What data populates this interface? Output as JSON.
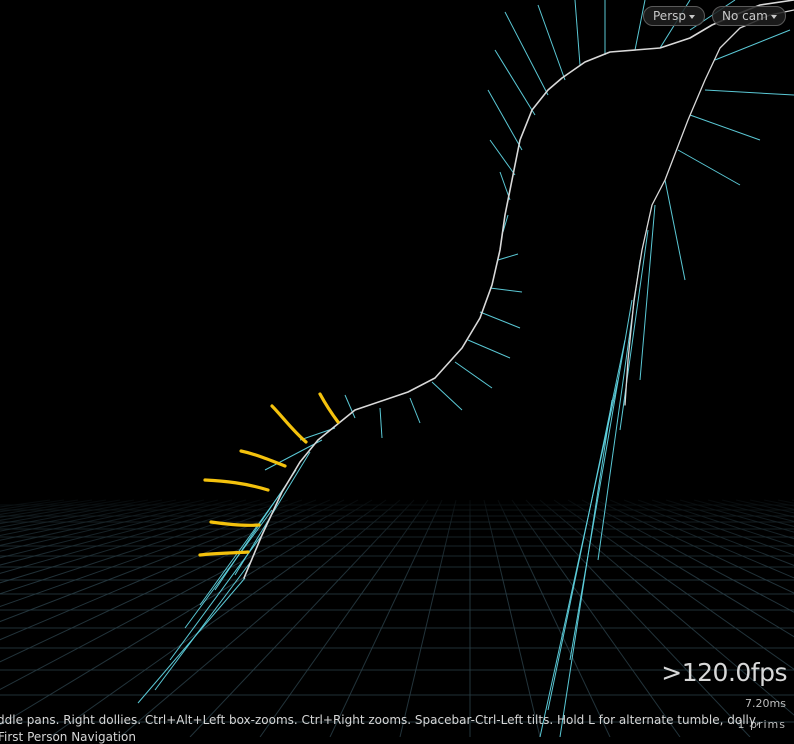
{
  "viewport": {
    "view_menu": "Persp",
    "camera_menu": "No cam",
    "fps": ">120.0fps",
    "frame_time": "7.20ms",
    "prims": "1 prims",
    "hint_line1": "ddle pans. Right dollies. Ctrl+Alt+Left box-zooms. Ctrl+Right zooms. Spacebar-Ctrl-Left tilts. Hold L for alternate tumble, dolly,",
    "hint_line2": "First Person Navigation"
  },
  "colors": {
    "background": "#000000",
    "curve": "#d9d9d9",
    "normals": "#5fd3e0",
    "annotation": "#f4c20d",
    "grid": "#2a4048"
  }
}
